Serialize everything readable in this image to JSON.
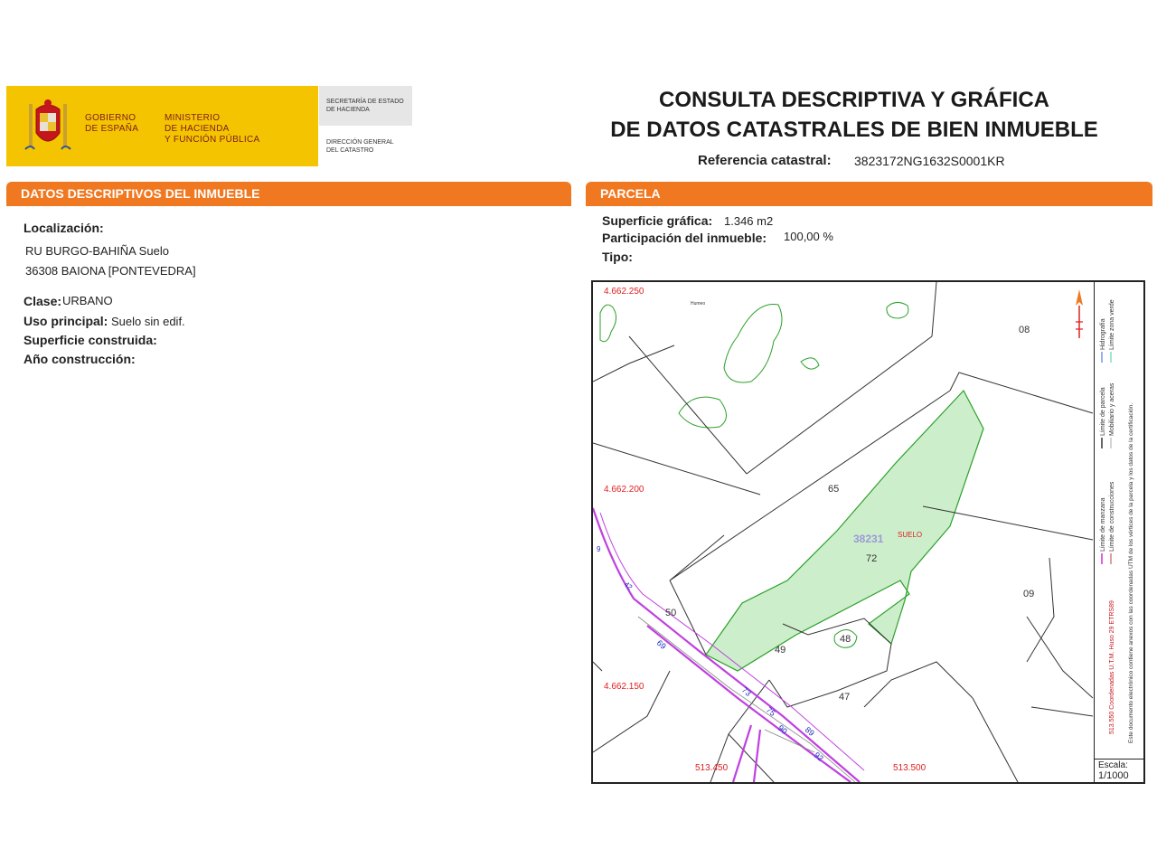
{
  "header": {
    "gov_line1": "GOBIERNO",
    "gov_line2": "DE ESPAÑA",
    "min_line1": "MINISTERIO",
    "min_line2": "DE HACIENDA",
    "min_line3": "Y FUNCIÓN PÚBLICA",
    "sec_line1": "SECRETARÍA DE ESTADO",
    "sec_line2": "DE HACIENDA",
    "dg_line1": "DIRECCIÓN GENERAL",
    "dg_line2": "DEL CATASTRO",
    "title_line1": "CONSULTA DESCRIPTIVA Y GRÁFICA",
    "title_line2": "DE DATOS CATASTRALES DE BIEN INMUEBLE",
    "ref_label": "Referencia catastral:",
    "ref_value": "3823172NG1632S0001KR"
  },
  "left": {
    "section_title": "DATOS DESCRIPTIVOS DEL INMUEBLE",
    "localizacion_label": "Localización:",
    "address_line1": "RU BURGO-BAHIÑA  Suelo",
    "address_line2": "36308 BAIONA [PONTEVEDRA]",
    "clase_label": "Clase:",
    "clase_value": "URBANO",
    "uso_label": "Uso principal:",
    "uso_value": "Suelo sin edif.",
    "superficie_label": "Superficie construida:",
    "anio_label": "Año construcción:"
  },
  "right": {
    "section_title": "PARCELA",
    "superficie_label": "Superficie gráfica:",
    "superficie_value": "1.346 m2",
    "participacion_label": "Participación del inmueble:",
    "participacion_value": "100,00 %",
    "tipo_label": "Tipo:"
  },
  "map": {
    "coords": {
      "y1": "4.662.250",
      "y2": "4.662.200",
      "y3": "4.662.150",
      "x1": "513.450",
      "x2": "513.500"
    },
    "parcels": {
      "p08": "08",
      "p65": "65",
      "p72": "72",
      "p09": "09",
      "p50": "50",
      "p49": "49",
      "p48": "48",
      "p47": "47"
    },
    "block_label": "38231",
    "suelo_label": "SUELO",
    "top_label": "Humeo",
    "street_numbers": {
      "s69": "69",
      "s73": "73",
      "s75": "75",
      "s90": "90",
      "s89": "89",
      "s92": "92",
      "s9": "9",
      "s42": "42"
    },
    "legend": {
      "l1": "Límite de manzana",
      "l2": "Límite de construcciones",
      "l3": "Límite de parcela",
      "l4": "Mobiliario y aceras",
      "l5": "Hidrografía",
      "l6": "Límite zona verde",
      "coords_note": "513.550 Coordenadas U.T.M. Huso 29 ETRS89",
      "doc_note": "Este documento electrónico contiene anexos con las coordenadas UTM de los vértices de la parcela y los datos de la certificación."
    },
    "scale_label": "Escala:",
    "scale_value": "1/1000"
  },
  "colors": {
    "accent_orange": "#f07820",
    "gov_yellow": "#f5c400",
    "parcel_fill": "#cdeecb",
    "parcel_stroke": "#2aa02a",
    "road_magenta": "#c040e0",
    "coord_red": "#e02020",
    "street_blue": "#2030c0"
  }
}
